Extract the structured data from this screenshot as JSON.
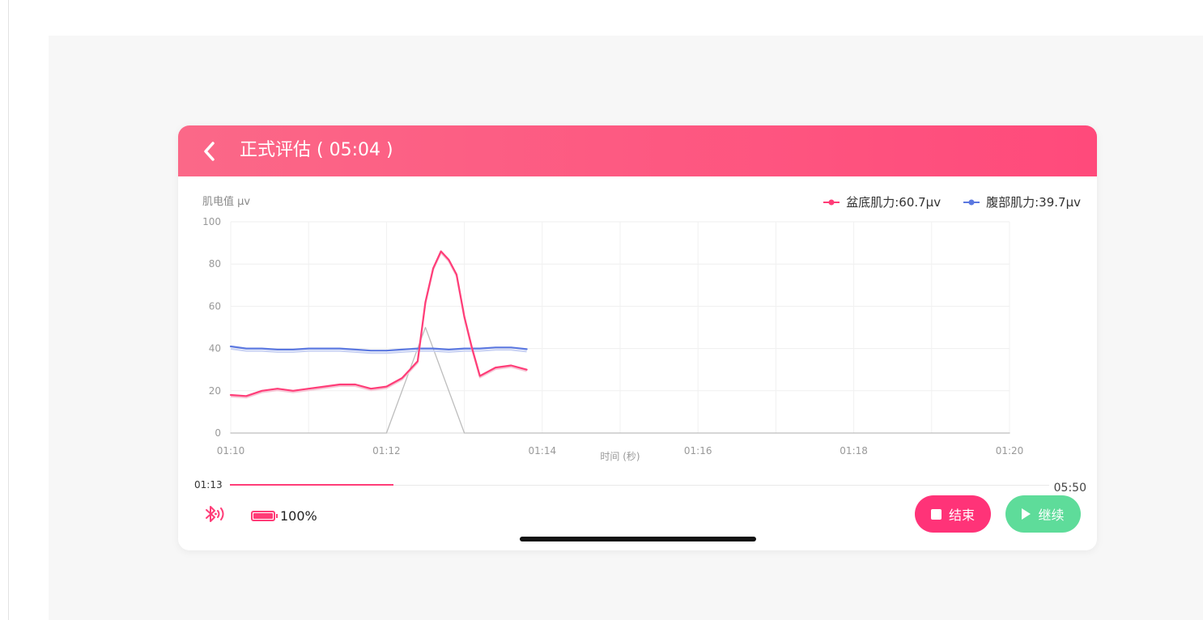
{
  "header": {
    "title": "正式评估 ( 05:04 )",
    "back_icon": "chevron-left-icon"
  },
  "chart": {
    "y_axis_label": "肌电值 μv",
    "legend": [
      {
        "label": "盆底肌力: ",
        "value": "60.7μv",
        "color": "#ff3d78"
      },
      {
        "label": "腹部肌力: ",
        "value": "39.7μv",
        "color": "#5b78e0"
      }
    ]
  },
  "chart_data": {
    "type": "line",
    "ylabel": "肌电值 μv",
    "xlabel": "时间 (秒)",
    "ylim": [
      0,
      100
    ],
    "yticks": [
      "0",
      "20",
      "40",
      "60",
      "80",
      "100"
    ],
    "xticks": [
      "01:10",
      "01:12",
      "01:14",
      "01:16",
      "01:18",
      "01:20"
    ],
    "xlim_seconds_ticks": [
      70,
      72,
      74,
      76,
      78,
      80
    ],
    "grid": true,
    "legend_position": "top-right",
    "series": [
      {
        "name": "盆底肌力",
        "color": "#ff3d78",
        "x": [
          70.0,
          70.2,
          70.4,
          70.6,
          70.8,
          71.0,
          71.2,
          71.4,
          71.6,
          71.8,
          72.0,
          72.2,
          72.3,
          72.4,
          72.5,
          72.6,
          72.7,
          72.8,
          72.9,
          73.0,
          73.1,
          73.2,
          73.4,
          73.6,
          73.8
        ],
        "y": [
          18,
          17.5,
          20,
          21,
          20,
          21,
          22,
          23,
          23,
          21,
          22,
          26,
          30,
          34,
          62,
          78,
          86,
          82,
          75,
          55,
          40,
          27,
          31,
          32,
          30
        ]
      },
      {
        "name": "腹部肌力",
        "color": "#5b78e0",
        "x": [
          70.0,
          70.2,
          70.4,
          70.6,
          70.8,
          71.0,
          71.2,
          71.4,
          71.6,
          71.8,
          72.0,
          72.2,
          72.4,
          72.6,
          72.8,
          73.0,
          73.2,
          73.4,
          73.6,
          73.8
        ],
        "y": [
          41,
          40,
          40,
          39.5,
          39.5,
          40,
          40,
          40,
          39.5,
          39,
          39,
          39.5,
          40,
          40,
          39.5,
          40,
          40,
          40.5,
          40.5,
          39.7
        ]
      },
      {
        "color": "#bdbdbd",
        "x": [
          70.0,
          72.0,
          72.5,
          73.0,
          80.0
        ],
        "y": [
          0,
          0,
          50,
          0,
          0
        ]
      }
    ]
  },
  "progress": {
    "current": "01:13",
    "total": "05:50",
    "fraction": 0.2
  },
  "status": {
    "bluetooth_icon": "bluetooth-icon",
    "battery_icon": "battery-icon",
    "battery_percent": "100%",
    "battery_fraction": 1.0
  },
  "buttons": {
    "end_label": "结束",
    "continue_label": "继续",
    "end_color": "#ff3378",
    "continue_color": "#5edc9a"
  }
}
